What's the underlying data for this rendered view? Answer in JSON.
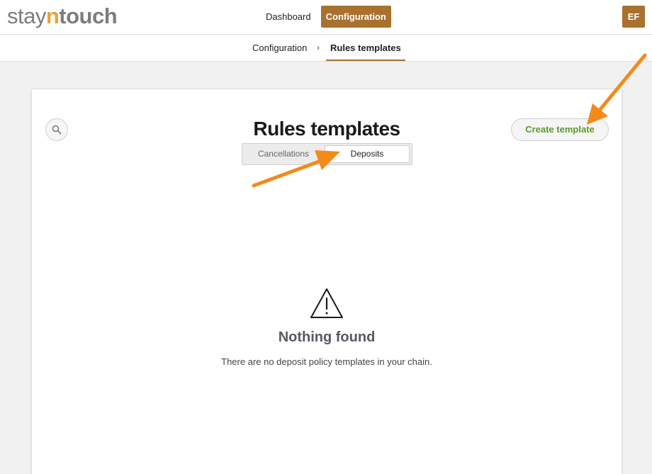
{
  "app": {
    "logo": {
      "part1": "stay",
      "part2": "n",
      "part3": "touch"
    },
    "nav": [
      {
        "label": "Dashboard",
        "active": false
      },
      {
        "label": "Configuration",
        "active": true
      }
    ],
    "avatar": "EF",
    "accent_color": "#a8712e"
  },
  "breadcrumb": {
    "parent": "Configuration",
    "separator": "›",
    "current": "Rules templates"
  },
  "main": {
    "title": "Rules templates",
    "create_button": "Create template",
    "search_icon": "search-icon",
    "tabs": [
      {
        "label": "Cancellations",
        "selected": false
      },
      {
        "label": "Deposits",
        "selected": true
      }
    ],
    "empty_state": {
      "icon": "warning-icon",
      "title": "Nothing found",
      "message": "There are no deposit policy templates in your chain."
    }
  },
  "annotations": {
    "arrow_color": "#f28a1c"
  }
}
